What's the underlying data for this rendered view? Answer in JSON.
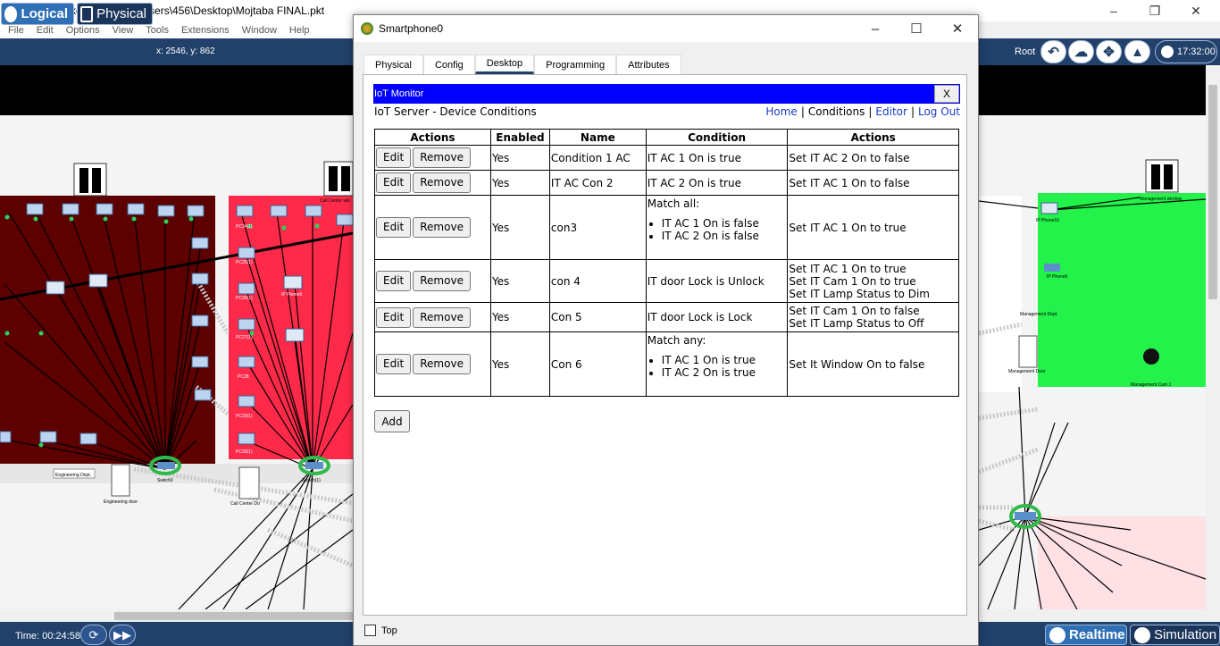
{
  "app": {
    "title": "Cisco Packet Tracer - C:\\Users\\456\\Desktop\\Mojtaba FINAL.pkt",
    "menu": [
      "File",
      "Edit",
      "Options",
      "View",
      "Tools",
      "Extensions",
      "Window",
      "Help"
    ],
    "toolbar": {
      "logical_label": "Logical",
      "physical_label": "Physical",
      "coords": "x: 2546, y: 862",
      "root_label": "Root",
      "clock": "17:32:00"
    },
    "status": {
      "time": "Time: 00:24:58",
      "realtime_label": "Realtime",
      "simulation_label": "Simulation"
    }
  },
  "workspace": {
    "labels": {
      "eng_dept": "Engineering Dept.",
      "eng_door": "Engineering door",
      "switch0": "Switch0",
      "switch1": "Switch(1)",
      "call_center_win": "Call Center win",
      "call_center_door": "Call Center Do",
      "mgmt_window": "Management window",
      "mgmt_dept": "Management Dept.",
      "mgmt_door": "Management Door",
      "mgmt_cam": "Management Cam 1",
      "ip_phone_16": "IP Phone16",
      "phone_ip": "IP Phone5",
      "ip_phone_6": "IP Phone6",
      "pc_labels": [
        "PC24(1)",
        "PC25(1)",
        "PC26(1)",
        "PC26(1)",
        "PC27(1)",
        "PC28",
        "PC29(1)",
        "PC30(1)"
      ]
    }
  },
  "phone": {
    "title": "Smartphone0",
    "tabs": [
      "Physical",
      "Config",
      "Desktop",
      "Programming",
      "Attributes"
    ],
    "active_tab": "Desktop",
    "top_checkbox_label": "Top",
    "iot": {
      "bar_title": "IoT Monitor",
      "close_label": "X",
      "heading": "IoT Server - Device Conditions",
      "nav": {
        "home": "Home",
        "conditions": "Conditions",
        "editor": "Editor",
        "logout": "Log Out",
        "sep": "|"
      },
      "columns": [
        "Actions",
        "Enabled",
        "Name",
        "Condition",
        "Actions"
      ],
      "edit_label": "Edit",
      "remove_label": "Remove",
      "add_label": "Add",
      "rows": [
        {
          "enabled": "Yes",
          "name": "Condition 1 AC",
          "condition_text": "IT AC 1 On is true",
          "condition_items": [],
          "actions": [
            "Set IT AC 2 On to false"
          ]
        },
        {
          "enabled": "Yes",
          "name": "IT AC Con 2",
          "condition_text": "IT AC 2 On is true",
          "condition_items": [],
          "actions": [
            "Set IT AC 1 On to false"
          ]
        },
        {
          "enabled": "Yes",
          "name": "con3",
          "condition_text": "Match all:",
          "condition_items": [
            "IT AC 1 On is false",
            "IT AC 2 On is false"
          ],
          "actions": [
            "Set IT AC 1 On to true"
          ]
        },
        {
          "enabled": "Yes",
          "name": "con 4",
          "condition_text": "IT door Lock is Unlock",
          "condition_items": [],
          "actions": [
            "Set IT AC 1 On to true",
            "Set IT Cam 1 On to true",
            "Set IT Lamp Status to Dim"
          ]
        },
        {
          "enabled": "Yes",
          "name": "Con 5",
          "condition_text": "IT door Lock is Lock",
          "condition_items": [],
          "actions": [
            "Set IT Cam 1 On to false",
            "Set IT Lamp Status to Off"
          ]
        },
        {
          "enabled": "Yes",
          "name": "Con 6",
          "condition_text": "Match any:",
          "condition_items": [
            "IT AC 1 On is true",
            "IT AC 2 On is true"
          ],
          "actions": [
            "Set It Window On to false"
          ]
        }
      ]
    }
  },
  "colors": {
    "toolbar_bg": "#21416a",
    "iot_bar": "#0000ff",
    "eng_dept": "#5c0000",
    "call_center": "#ff2a4a",
    "mgmt_dept": "#22f24a",
    "link": "#1a3cc8"
  }
}
